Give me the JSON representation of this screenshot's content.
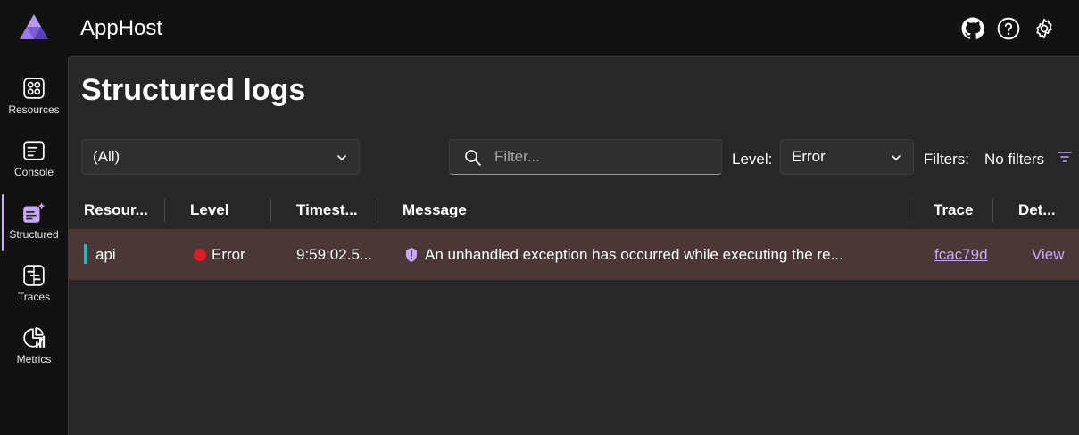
{
  "app": {
    "title": "AppHost"
  },
  "header": {
    "icons": [
      "github-icon",
      "help-icon",
      "settings-icon"
    ]
  },
  "sidebar": {
    "items": [
      {
        "label": "Resources",
        "icon": "resources-icon"
      },
      {
        "label": "Console",
        "icon": "console-icon"
      },
      {
        "label": "Structured",
        "icon": "structured-icon",
        "active": true
      },
      {
        "label": "Traces",
        "icon": "traces-icon"
      },
      {
        "label": "Metrics",
        "icon": "metrics-icon"
      }
    ]
  },
  "page": {
    "title": "Structured logs"
  },
  "toolbar": {
    "resource_select": "(All)",
    "filter_placeholder": "Filter...",
    "level_label": "Level:",
    "level_select": "Error",
    "filters_label": "Filters:",
    "filters_value": "No filters"
  },
  "table": {
    "headers": [
      "Resour...",
      "Level",
      "Timest...",
      "Message",
      "Trace",
      "Det..."
    ],
    "rows": [
      {
        "resource": "api",
        "level": "Error",
        "timestamp": "9:59:02.5...",
        "message": "An unhandled exception has occurred while executing the re...",
        "trace": "fcac79d",
        "details": "View"
      }
    ]
  },
  "colors": {
    "accent": "#c7a9f7",
    "error": "#e01b24",
    "resource": "#2ab3c0",
    "error_row": "#4a3736",
    "panel": "#272727",
    "chrome": "#121212"
  }
}
